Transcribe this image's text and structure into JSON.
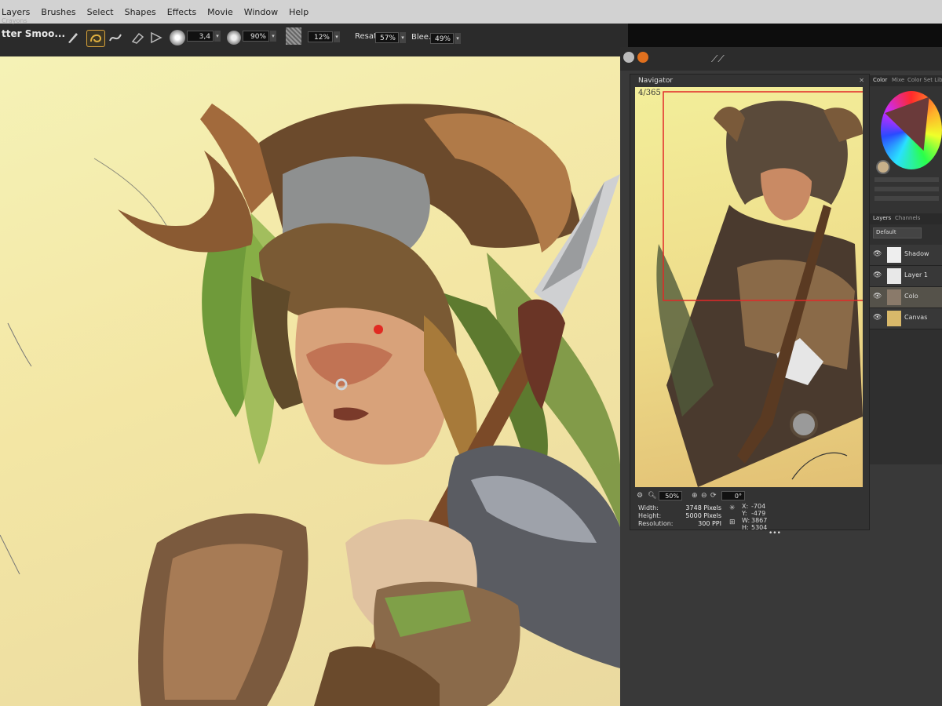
{
  "menu": {
    "items": [
      "Layers",
      "Brushes",
      "Select",
      "Shapes",
      "Effects",
      "Movie",
      "Window",
      "Help"
    ]
  },
  "propbar": {
    "brush_category": "Crayons",
    "brush_name": "tter Smoo...",
    "size_value": "3,4",
    "opacity_value": "90%",
    "grain_value": "12%",
    "resat_label": "Resat:",
    "resat_value": "57%",
    "bleed_label": "Blee...",
    "bleed_value": "49%"
  },
  "navigator": {
    "title": "Navigator",
    "note": "4/365",
    "zoom_value": "50%",
    "rotation_value": "0°",
    "width_label": "Width:",
    "width_value": "3748 Pixels",
    "height_label": "Height:",
    "height_value": "5000 Pixels",
    "resolution_label": "Resolution:",
    "resolution_value": "300 PPI",
    "x_label": "X:",
    "x_value": "-704",
    "y_label": "Y:",
    "y_value": "-479",
    "w_label": "W:",
    "w_value": "3867",
    "h_label": "H:",
    "h_value": "5304",
    "more": "•••"
  },
  "color_panel": {
    "tabs": [
      "Color",
      "Mixe",
      "Color Set Librarie"
    ]
  },
  "layers_panel": {
    "tabs": [
      "Layers",
      "Channels"
    ],
    "composite": "Default",
    "layers": [
      "Shadow",
      "Layer 1",
      "Colo",
      "Canvas"
    ]
  },
  "colors": {
    "canvas_bg": "#f3e6a4",
    "nav_rect": "#e22828",
    "accent_active_tool": "#d9a23a"
  },
  "icons": {
    "tool_icons": [
      "pen-tool-icon",
      "lasso-icon",
      "brush-stroke-icon",
      "rectangle-icon",
      "eraser-icon"
    ]
  }
}
